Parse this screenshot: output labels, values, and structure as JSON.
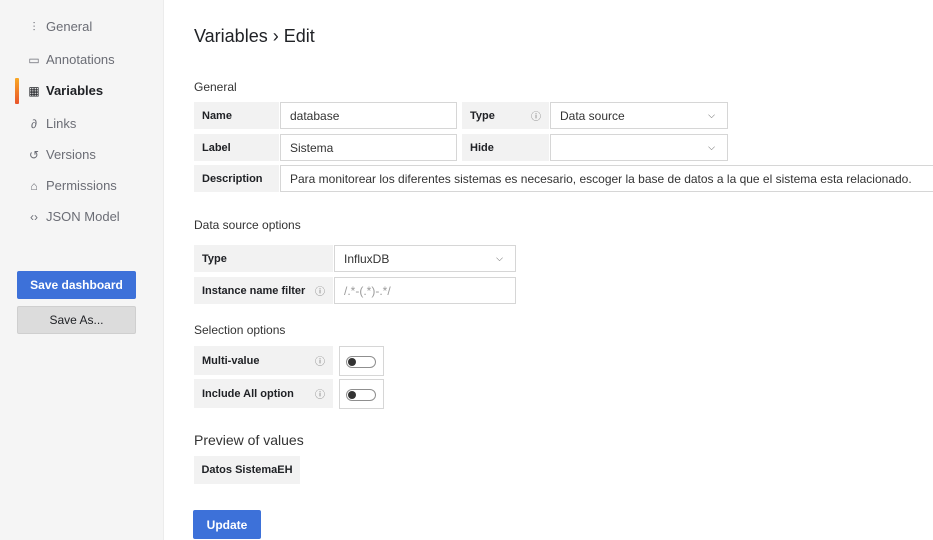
{
  "sidebar": {
    "items": [
      {
        "label": "General",
        "icon": "sliders-icon"
      },
      {
        "label": "Annotations",
        "icon": "comment-icon"
      },
      {
        "label": "Variables",
        "icon": "calculator-icon"
      },
      {
        "label": "Links",
        "icon": "link-icon"
      },
      {
        "label": "Versions",
        "icon": "history-icon"
      },
      {
        "label": "Permissions",
        "icon": "lock-icon"
      },
      {
        "label": "JSON Model",
        "icon": "code-icon"
      }
    ],
    "save_dashboard": "Save dashboard",
    "save_as": "Save As..."
  },
  "page": {
    "title": "Variables › Edit"
  },
  "general": {
    "heading": "General",
    "name_label": "Name",
    "name_value": "database",
    "type_label": "Type",
    "type_value": "Data source",
    "label_label": "Label",
    "label_value": "Sistema",
    "hide_label": "Hide",
    "hide_value": "",
    "description_label": "Description",
    "description_value": "Para monitorear los diferentes sistemas es necesario, escoger la base de datos a la que el sistema esta relacionado."
  },
  "datasource": {
    "heading": "Data source options",
    "type_label": "Type",
    "type_value": "InfluxDB",
    "filter_label": "Instance name filter",
    "filter_placeholder": "/.*-(.*)-.*/"
  },
  "selection": {
    "heading": "Selection options",
    "multi_value_label": "Multi-value",
    "include_all_label": "Include All option"
  },
  "preview": {
    "heading": "Preview of values",
    "values": [
      "Datos SistemaEH"
    ]
  },
  "actions": {
    "update": "Update"
  },
  "colors": {
    "primary": "#3d71d9",
    "active_accent_top": "#f9a825",
    "active_accent_bottom": "#e8542b"
  }
}
